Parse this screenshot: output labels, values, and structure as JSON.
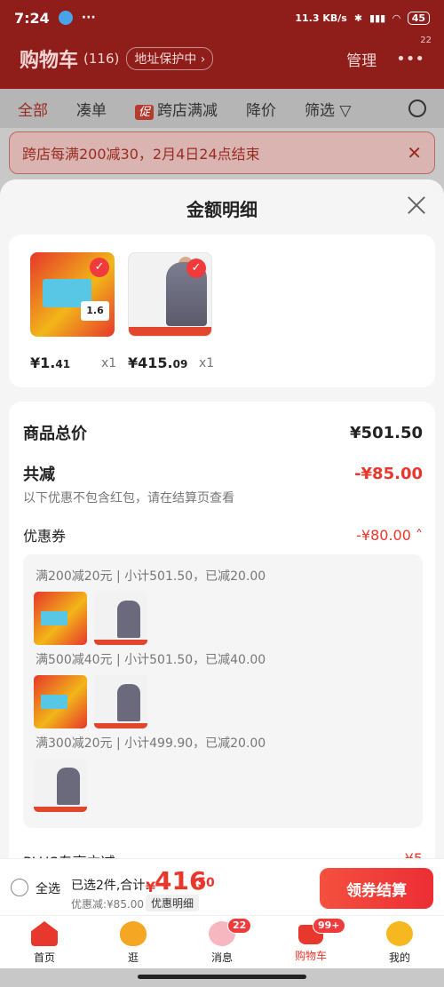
{
  "status_bar": {
    "time": "7:24",
    "dots": "···",
    "net": "11.3 KB/s",
    "battery": "45"
  },
  "header": {
    "title": "购物车",
    "count": "(116)",
    "address": "地址保护中 ›",
    "manage": "管理",
    "more_dots": "•••",
    "more_badge": "22"
  },
  "filters": {
    "all": "全部",
    "combo": "凑单",
    "promo_tag": "促",
    "cross_store": "跨店满减",
    "price_drop": "降价",
    "filter": "筛选"
  },
  "promo_banner": {
    "text": "跨店每满200减30，2月4日24点结束",
    "close": "✕"
  },
  "sheet": {
    "title": "金额明细"
  },
  "products": [
    {
      "price_int": "¥1.",
      "price_dec": "41",
      "qty": "x1",
      "tag": "1.6",
      "check": "✓"
    },
    {
      "price_int": "¥415.",
      "price_dec": "09",
      "qty": "x1",
      "check": "✓"
    }
  ],
  "summary": {
    "goods_total_label": "商品总价",
    "goods_total_value": "¥501.50",
    "reduce_label": "共减",
    "reduce_value": "-¥85.00",
    "reduce_note": "以下优惠不包含红包，请在结算页查看",
    "coupon_label": "优惠券",
    "coupon_value": "-¥80.00 ˄",
    "coupon_groups": [
      {
        "title": "满200减20元 | 小计501.50，已减20.00"
      },
      {
        "title": "满500减40元 | 小计501.50，已减40.00"
      },
      {
        "title": "满300减20元 | 小计499.90，已减20.00"
      }
    ],
    "plus_label": "PLUS专享立减",
    "plus_value": "-¥5"
  },
  "checkout": {
    "select_all": "全选",
    "selected_text": "已选2件,合计:",
    "total_symbol": "¥",
    "total_int": "416",
    "total_dec": ".50",
    "discount_text": "优惠减:¥85.00",
    "detail_link": "优惠明细",
    "button": "领券结算"
  },
  "nav": [
    {
      "label": "首页"
    },
    {
      "label": "逛"
    },
    {
      "label": "消息",
      "badge": "22"
    },
    {
      "label": "购物车",
      "badge": "99+"
    },
    {
      "label": "我的"
    }
  ]
}
